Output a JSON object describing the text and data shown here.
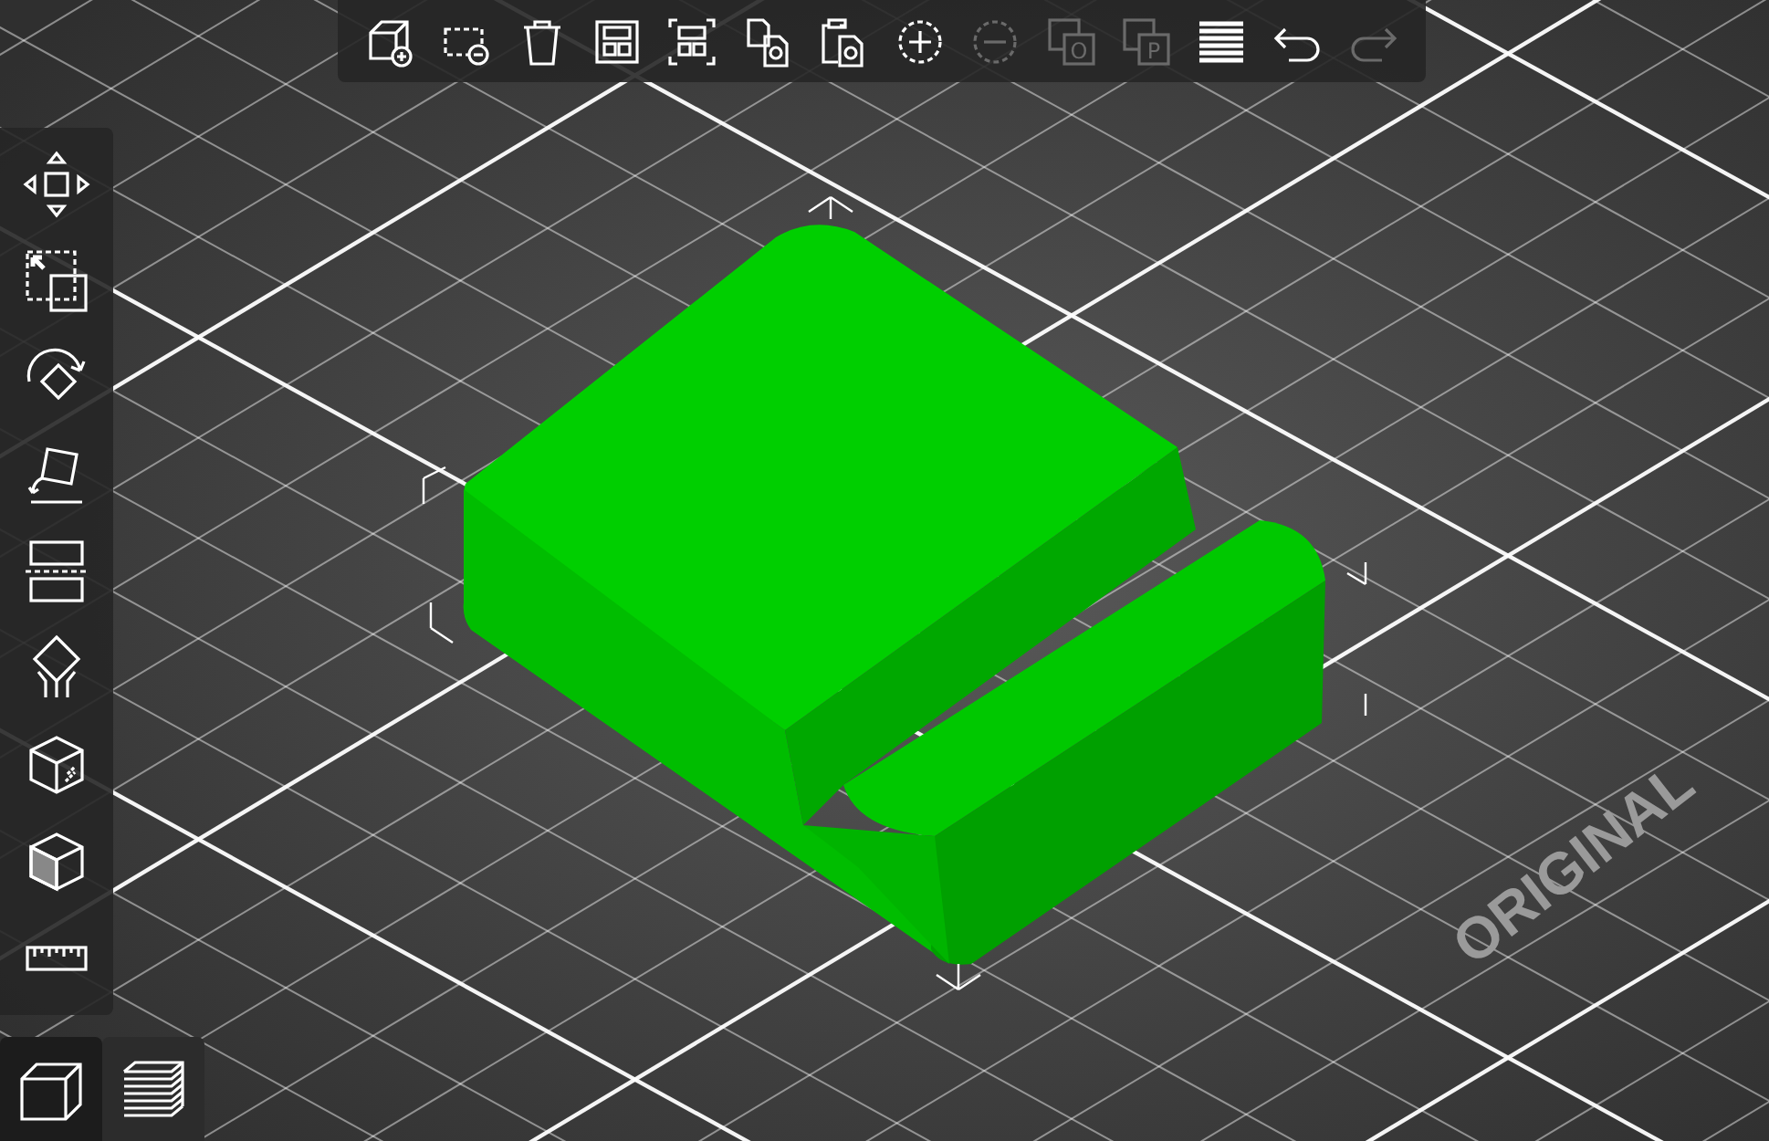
{
  "top_toolbar": [
    {
      "kind": "add",
      "disabled": false
    },
    {
      "kind": "delete",
      "disabled": false
    },
    {
      "kind": "delete_all",
      "disabled": false
    },
    {
      "kind": "arrange",
      "disabled": false
    },
    {
      "kind": "arrange_selection",
      "disabled": false
    },
    {
      "kind": "copy",
      "disabled": false
    },
    {
      "kind": "paste",
      "disabled": false
    },
    {
      "kind": "add_instance",
      "disabled": false
    },
    {
      "kind": "remove_instance",
      "disabled": true
    },
    {
      "kind": "split_objects",
      "letter": "O",
      "disabled": true
    },
    {
      "kind": "split_parts",
      "letter": "P",
      "disabled": true
    },
    {
      "kind": "layers",
      "disabled": false
    },
    {
      "kind": "undo",
      "disabled": false
    },
    {
      "kind": "redo",
      "disabled": true
    }
  ],
  "left_toolbar": [
    {
      "kind": "move"
    },
    {
      "kind": "scale"
    },
    {
      "kind": "rotate"
    },
    {
      "kind": "place_on_face"
    },
    {
      "kind": "cut"
    },
    {
      "kind": "supports"
    },
    {
      "kind": "seam"
    },
    {
      "kind": "fdm"
    },
    {
      "kind": "measure"
    }
  ],
  "view_switch": [
    {
      "kind": "view_3d",
      "selected": true
    },
    {
      "kind": "preview",
      "selected": false
    }
  ],
  "bed_label": "ORIGINAL"
}
